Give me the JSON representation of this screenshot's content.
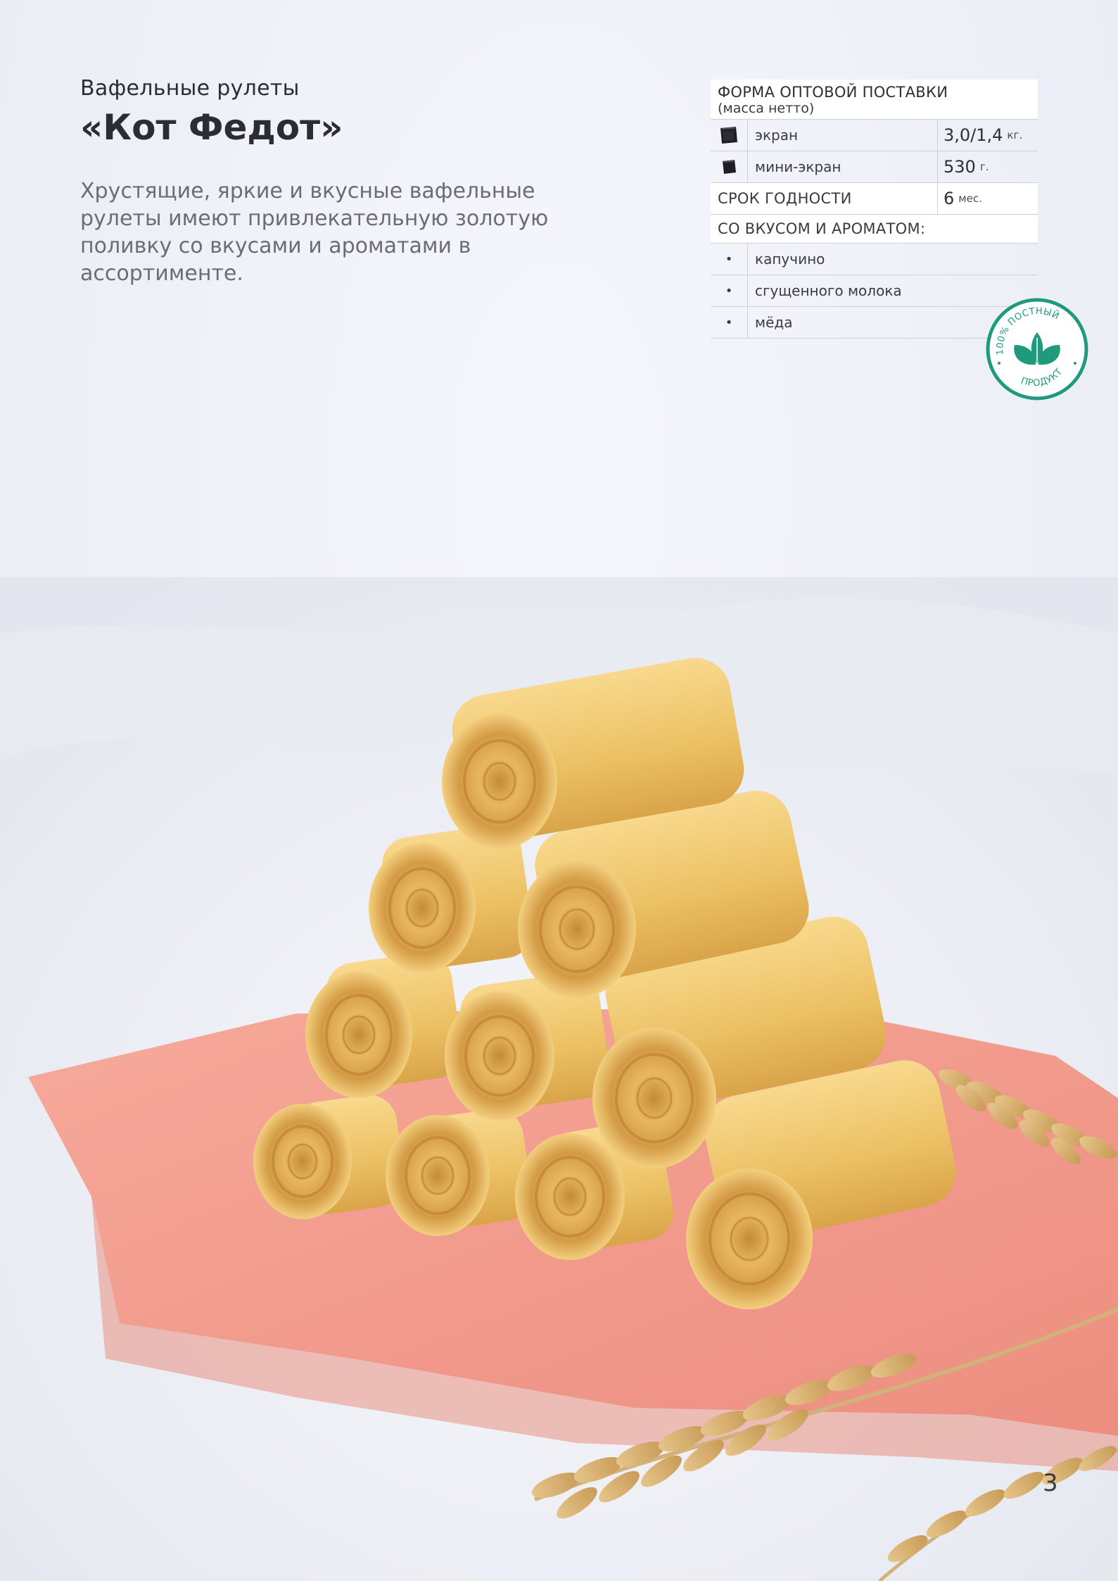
{
  "header": {
    "subtitle": "Вафельные рулеты",
    "title": "«Кот Федот»",
    "description": "Хрустящие, яркие и вкусные вафельные рулеты имеют привлекательную золотую поливку со вкусами и ароматами в ассортименте."
  },
  "spec": {
    "header_main": "ФОРМА ОПТОВОЙ ПОСТАВКИ",
    "header_sub": "(масса нетто)",
    "packaging": [
      {
        "name": "экран",
        "value": "3,0/1,4",
        "unit": "кг.",
        "icon": "box-icon"
      },
      {
        "name": "мини-экран",
        "value": "530",
        "unit": "г.",
        "icon": "small-box-icon"
      }
    ],
    "shelf_life": {
      "label": "СРОК ГОДНОСТИ",
      "value": "6",
      "unit": "мес."
    },
    "flavors_header": "СО ВКУСОМ И АРОМАТОМ:",
    "bullet": "•",
    "flavors": [
      "капучино",
      "сгущенного молока",
      "мёда"
    ]
  },
  "badge": {
    "top_text": "100% ПОСТНЫЙ",
    "bottom_text": "ПРОДУКТ",
    "icon": "leaves-icon",
    "color": "#1f9a7c"
  },
  "page_number": "3",
  "colors": {
    "background": "#eef0f8",
    "paper": "#f29a8c",
    "wafer": "#eec36a",
    "wafer_dark": "#c98f3a",
    "wheat": "#d2ad6b"
  }
}
